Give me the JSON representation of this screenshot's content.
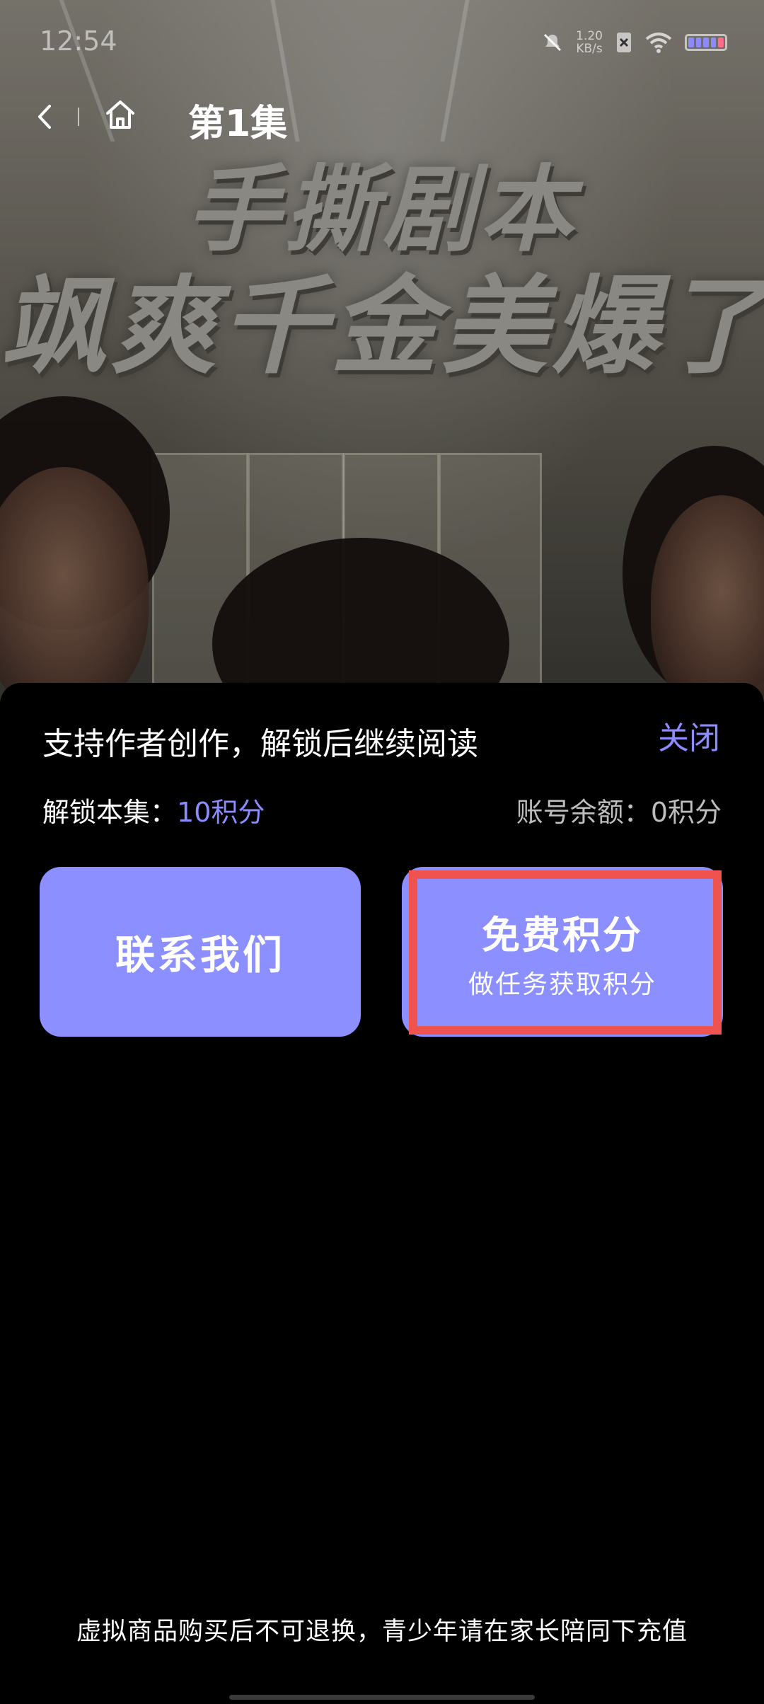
{
  "status_bar": {
    "time": "12:54",
    "net_speed_value": "1.20",
    "net_speed_unit": "KB/s",
    "icons": [
      "mute-icon",
      "sim-off-icon",
      "wifi-icon",
      "battery-icon"
    ]
  },
  "nav": {
    "title": "第1集",
    "back_icon": "chevron-left-icon",
    "home_icon": "home-icon"
  },
  "video": {
    "poster_title_line1": "手撕剧本",
    "poster_title_line2": "飒爽千金美爆了"
  },
  "unlock_sheet": {
    "heading": "支持作者创作，解锁后继续阅读",
    "close_label": "关闭",
    "cost_label": "解锁本集：",
    "cost_value": "10积分",
    "balance_label": "账号余额：",
    "balance_value": "0积分",
    "contact_button": "联系我们",
    "free_points_button": "免费积分",
    "free_points_subtitle": "做任务获取积分",
    "footer_note": "虚拟商品购买后不可退换，青少年请在家长陪同下充值",
    "accent_color": "#8b8fff",
    "highlight_color": "#ef5350"
  }
}
